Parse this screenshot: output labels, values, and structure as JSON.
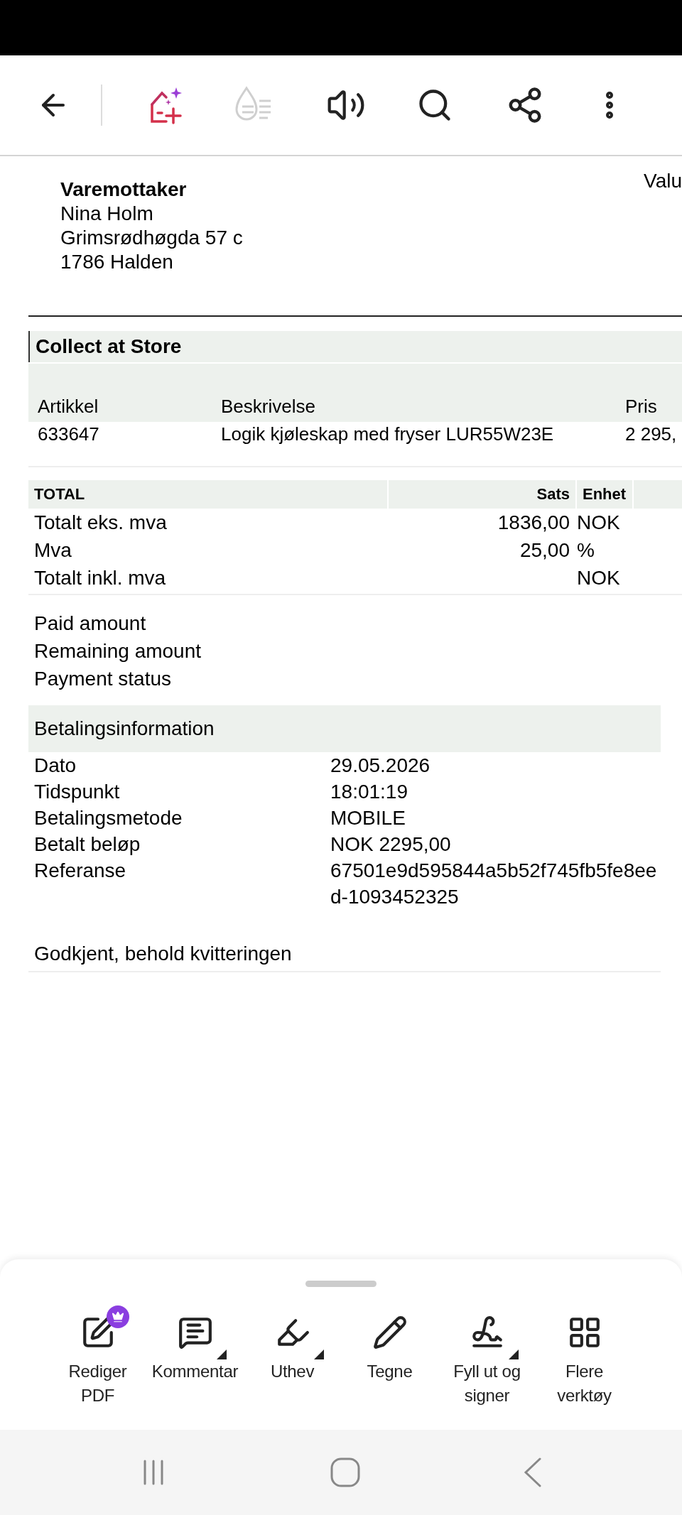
{
  "top_bar": {
    "items": [
      {
        "kind": "back",
        "disabled": false
      },
      {
        "kind": "app",
        "disabled": false
      },
      {
        "kind": "liquid",
        "disabled": true
      },
      {
        "kind": "speaker",
        "disabled": false
      },
      {
        "kind": "search",
        "disabled": false
      },
      {
        "kind": "share",
        "disabled": false
      },
      {
        "kind": "more",
        "disabled": false
      }
    ]
  },
  "document": {
    "recipient": {
      "heading": "Varemottaker",
      "lines": [
        "Nina Holm",
        "Grimsrødhøgda 57 c",
        "1786 Halden"
      ]
    },
    "top_right": "Valu",
    "section_title": "Collect at Store",
    "items": {
      "columns": [
        "Artikkel",
        "Beskrivelse",
        "Pris"
      ],
      "rows": [
        [
          "633647",
          "Logik kjøleskap med fryser LUR55W23E",
          "2 295,"
        ]
      ]
    },
    "totals": {
      "columns": [
        "TOTAL",
        "Sats",
        "Enhet"
      ],
      "rows": [
        {
          "label": "Totalt eks. mva",
          "rate": "1836,00",
          "unit": "NOK"
        },
        {
          "label": "Mva",
          "rate": "25,00",
          "unit": "%"
        },
        {
          "label": "Totalt inkl. mva",
          "rate": "",
          "unit": "NOK"
        }
      ]
    },
    "payment_summary": [
      "Paid amount",
      "Remaining amount",
      "Payment status"
    ],
    "payment_info": {
      "title": "Betalingsinformation",
      "rows": [
        {
          "label": "Dato",
          "value": "29.05.2026"
        },
        {
          "label": "Tidspunkt",
          "value": "18:01:19"
        },
        {
          "label": "Betalingsmetode",
          "value": "MOBILE"
        },
        {
          "label": "Betalt beløp",
          "value": "NOK 2295,00"
        },
        {
          "label": "Referanse",
          "value": "67501e9d595844a5b52f745fb5fe8eed-1093452325"
        }
      ]
    },
    "note": "Godkjent, behold kvitteringen"
  },
  "tools": [
    {
      "kind": "edit",
      "label": "Rediger PDF",
      "dropdown": false,
      "premium": true
    },
    {
      "kind": "comment",
      "label": "Kommentar",
      "dropdown": true,
      "premium": false
    },
    {
      "kind": "highlight",
      "label": "Uthev",
      "dropdown": true,
      "premium": false
    },
    {
      "kind": "draw",
      "label": "Tegne",
      "dropdown": false,
      "premium": false
    },
    {
      "kind": "sign",
      "label": "Fyll ut og signer",
      "dropdown": true,
      "premium": false
    },
    {
      "kind": "more",
      "label": "Flere verktøy",
      "dropdown": false,
      "premium": false
    }
  ]
}
